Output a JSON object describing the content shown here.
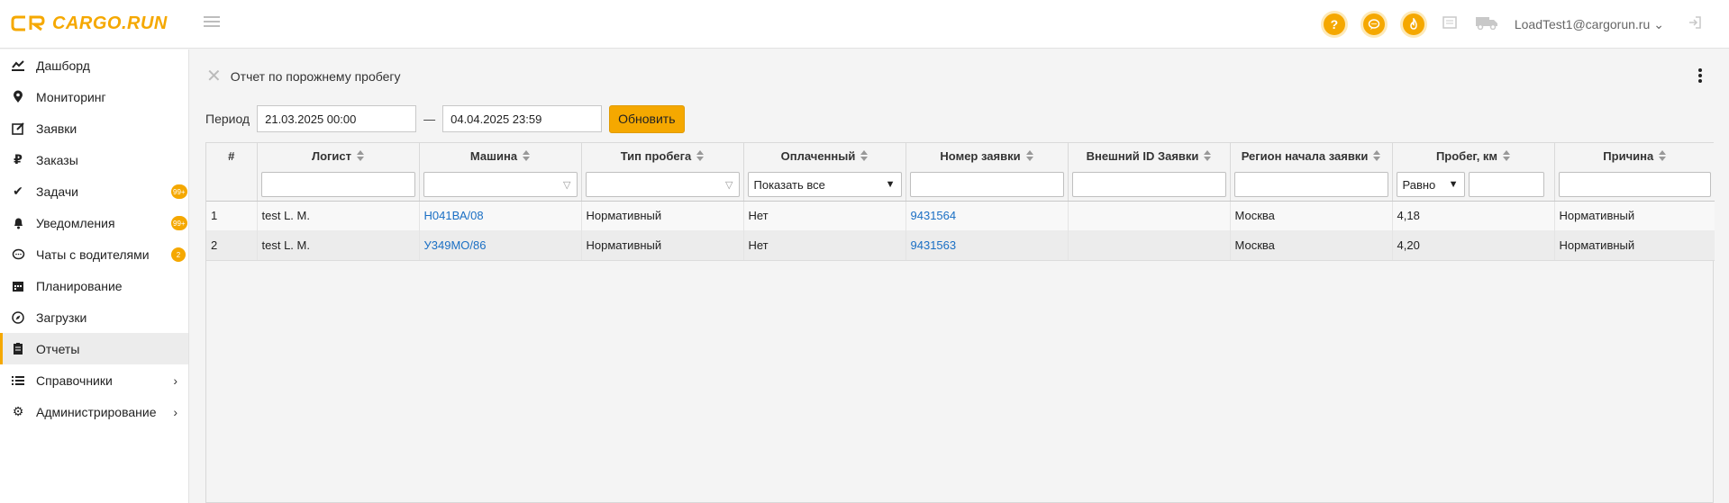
{
  "app": {
    "logo_text": "CARGO.RUN",
    "accent_color": "#f5a800"
  },
  "header": {
    "help_icon": "?",
    "user_email": "LoadTest1@cargorun.ru"
  },
  "sidebar": {
    "items": [
      {
        "label": "Дашборд",
        "icon": "dashboard-icon"
      },
      {
        "label": "Мониторинг",
        "icon": "map-pin-icon"
      },
      {
        "label": "Заявки",
        "icon": "edit-icon"
      },
      {
        "label": "Заказы",
        "icon": "ruble-icon"
      },
      {
        "label": "Задачи",
        "icon": "check-icon",
        "badge": "99+"
      },
      {
        "label": "Уведомления",
        "icon": "bell-icon",
        "badge": "99+"
      },
      {
        "label": "Чаты с водителями",
        "icon": "chat-icon",
        "badge": "2"
      },
      {
        "label": "Планирование",
        "icon": "calendar-icon"
      },
      {
        "label": "Загрузки",
        "icon": "compass-icon"
      },
      {
        "label": "Отчеты",
        "icon": "clipboard-icon",
        "active": true
      },
      {
        "label": "Справочники",
        "icon": "list-icon",
        "expandable": true
      },
      {
        "label": "Администрирование",
        "icon": "gear-icon",
        "expandable": true
      }
    ]
  },
  "page": {
    "title": "Отчет по порожнему пробегу",
    "period_label": "Период",
    "date_from": "21.03.2025 00:00",
    "date_separator": "—",
    "date_to": "04.04.2025 23:59",
    "refresh_label": "Обновить"
  },
  "table": {
    "columns": [
      {
        "label": "#"
      },
      {
        "label": "Логист"
      },
      {
        "label": "Машина"
      },
      {
        "label": "Тип пробега"
      },
      {
        "label": "Оплаченный"
      },
      {
        "label": "Номер заявки"
      },
      {
        "label": "Внешний ID Заявки"
      },
      {
        "label": "Регион начала заявки"
      },
      {
        "label": "Пробег, км"
      },
      {
        "label": "Причина"
      }
    ],
    "filters": {
      "paid": "Показать все",
      "mileage_op": "Равно"
    },
    "rows": [
      {
        "n": "1",
        "logist": "test L. M.",
        "vehicle": "Н041ВА/08",
        "type": "Нормативный",
        "paid": "Нет",
        "order": "9431564",
        "ext_id": "",
        "region": "Москва",
        "km": "4,18",
        "reason": "Нормативный"
      },
      {
        "n": "2",
        "logist": "test L. M.",
        "vehicle": "У349МО/86",
        "type": "Нормативный",
        "paid": "Нет",
        "order": "9431563",
        "ext_id": "",
        "region": "Москва",
        "km": "4,20",
        "reason": "Нормативный"
      }
    ]
  }
}
